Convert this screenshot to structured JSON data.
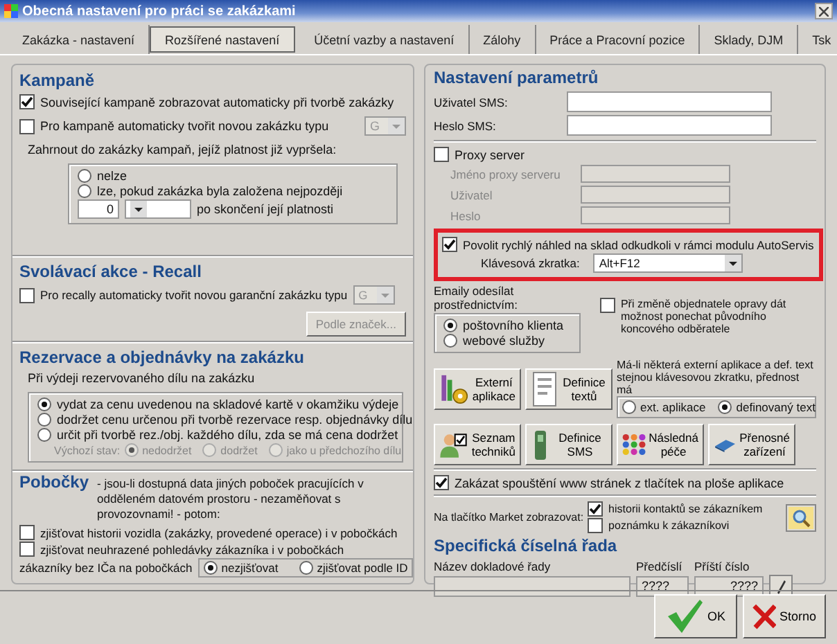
{
  "window": {
    "title": "Obecná nastavení pro práci se zakázkami"
  },
  "tabs": [
    {
      "label": "Zakázka - nastavení",
      "selected": false
    },
    {
      "label": "Rozšířené nastavení",
      "selected": true
    },
    {
      "label": "Účetní vazby a nastavení",
      "selected": false
    },
    {
      "label": "Zálohy",
      "selected": false
    },
    {
      "label": "Práce a Pracovní pozice",
      "selected": false
    },
    {
      "label": "Sklady, DJM",
      "selected": false
    },
    {
      "label": "Tsk",
      "selected": false
    }
  ],
  "campaigns": {
    "title": "Kampaně",
    "auto_show": {
      "label": "Související kampaně zobrazovat automaticky při tvorbě zakázky",
      "checked": true
    },
    "auto_create": {
      "label": "Pro kampaně automaticky tvořit novou zakázku typu",
      "checked": false,
      "type": "G",
      "type_disabled": true
    },
    "expired_label": "Zahrnout do zakázky kampaň, jejíž platnost již vypršela:",
    "expired_options": [
      {
        "label": "nelze",
        "selected": false
      },
      {
        "label": "lze, pokud zakázka byla založena nejpozději",
        "selected": false
      }
    ],
    "days": "0",
    "after_label": "po skončení její platnosti"
  },
  "recall": {
    "title": "Svolávací akce - Recall",
    "auto_create": {
      "label": "Pro recally automaticky tvořit novou garanční zakázku typu",
      "checked": false,
      "type": "G",
      "type_disabled": true
    },
    "brands_button": {
      "label": "Podle značek...",
      "disabled": true
    }
  },
  "reservations": {
    "title": "Rezervace a objednávky na zakázku",
    "prompt": "Při výdeji rezervovaného dílu na zakázku",
    "options": [
      {
        "label": "vydat za cenu uvedenou na skladové kartě v okamžiku výdeje",
        "selected": true
      },
      {
        "label": "dodržet cenu určenou při tvorbě rezervace resp. objednávky dílu",
        "selected": false
      },
      {
        "label": "určit při tvorbě rez./obj. každého dílu, zda se má cena dodržet",
        "selected": false
      }
    ],
    "default_label": "Výchozí stav:",
    "default_disabled": true,
    "default_options": [
      {
        "label": "nedodržet",
        "selected": true
      },
      {
        "label": "dodržet",
        "selected": false
      },
      {
        "label": "jako u předchozího dílu",
        "selected": false
      }
    ]
  },
  "branches": {
    "title": "Pobočky",
    "description": "- jsou-li dostupná data jiných poboček pracujících v odděleném datovém prostoru - nezaměňovat s provozovnami! - potom:",
    "checks": [
      {
        "label": "zjišťovat historii vozidla (zakázky, provedené operace) i v pobočkách",
        "checked": false
      },
      {
        "label": "zjišťovat neuhrazené pohledávky zákazníka i v pobočkách",
        "checked": false
      }
    ],
    "no_id_label": "zákazníky bez IČa na pobočkách",
    "no_id_options": [
      {
        "label": "nezjišťovat",
        "selected": true
      },
      {
        "label": "zjišťovat podle ID",
        "selected": false
      }
    ]
  },
  "parameters": {
    "title": "Nastavení parametrů",
    "sms_fields": [
      {
        "label": "Uživatel SMS:"
      },
      {
        "label": "Heslo SMS:"
      }
    ],
    "proxy": {
      "label": "Proxy server",
      "checked": false,
      "fields": [
        {
          "label": "Jméno proxy serveru"
        },
        {
          "label": "Uživatel"
        },
        {
          "label": "Heslo"
        }
      ]
    },
    "quick_view": {
      "label": "Povolit rychlý náhled na sklad odkudkoli v rámci modulu AutoServis",
      "checked": true,
      "shortcut_label": "Klávesová zkratka:",
      "shortcut": "Alt+F12"
    },
    "email_label": "Emaily odesílat prostřednictvím:",
    "email_options": [
      {
        "label": "poštovního klienta",
        "selected": true
      },
      {
        "label": "webové služby",
        "selected": false
      }
    ],
    "keep_recipient": {
      "label": "Při změně objednatele opravy dát možnost ponechat původního koncového odběratele",
      "checked": false
    },
    "tool_buttons": [
      {
        "label": "Externí aplikace"
      },
      {
        "label": "Definice textů"
      }
    ],
    "priority_label": "Má-li některá externí aplikace a def. text stejnou klávesovou zkratku, přednost má",
    "priority_options": [
      {
        "label": "ext. aplikace",
        "selected": false
      },
      {
        "label": "definovaný text",
        "selected": true
      }
    ],
    "module_buttons": [
      {
        "label": "Seznam techniků"
      },
      {
        "label": "Definice SMS"
      },
      {
        "label": "Následná péče"
      },
      {
        "label": "Přenosné zařízení"
      }
    ],
    "block_www": {
      "label": "Zakázat spouštění www stránek z tlačítek na ploše aplikace",
      "checked": true
    },
    "market_label": "Na tlačítko Market zobrazovat:",
    "market_options": [
      {
        "label": "historii kontaktů se zákazníkem",
        "checked": true
      },
      {
        "label": "poznámku k zákazníkovi",
        "checked": false
      }
    ]
  },
  "number_series": {
    "title": "Specifická číselná řada",
    "columns": [
      "Název dokladové řady",
      "Předčíslí",
      "Příští číslo"
    ],
    "prefix": "????",
    "next": "????"
  },
  "buttons": [
    {
      "label": "OK"
    },
    {
      "label": "Storno"
    }
  ]
}
